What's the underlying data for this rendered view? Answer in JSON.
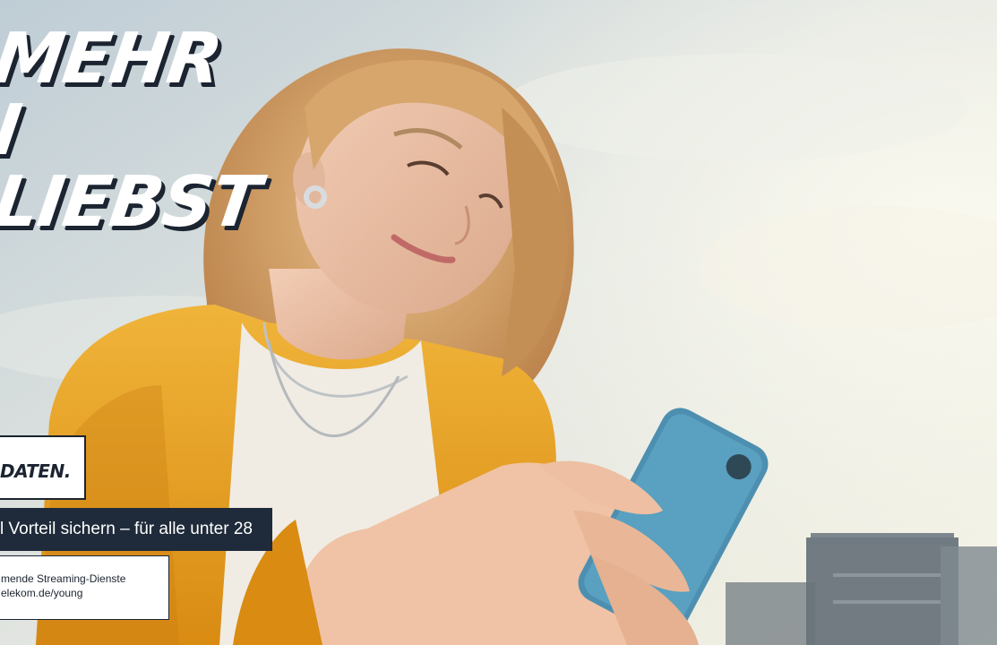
{
  "headline": {
    "line1": "MEHR",
    "line2": "I",
    "line3": "LIEBST"
  },
  "data_box": {
    "label": "DATEN."
  },
  "promo": {
    "text": "l Vorteil sichern – für alle unter 28"
  },
  "disclaimer": {
    "line1": "mende Streaming-Dienste",
    "line2": "elekom.de/young"
  },
  "colors": {
    "navy": "#1f2b3a",
    "white": "#ffffff",
    "jacket_yellow": "#e8a21c",
    "phone_blue": "#4d8fb0",
    "sky_top": "#cdd6dc",
    "sky_bottom": "#f2f1e2"
  }
}
